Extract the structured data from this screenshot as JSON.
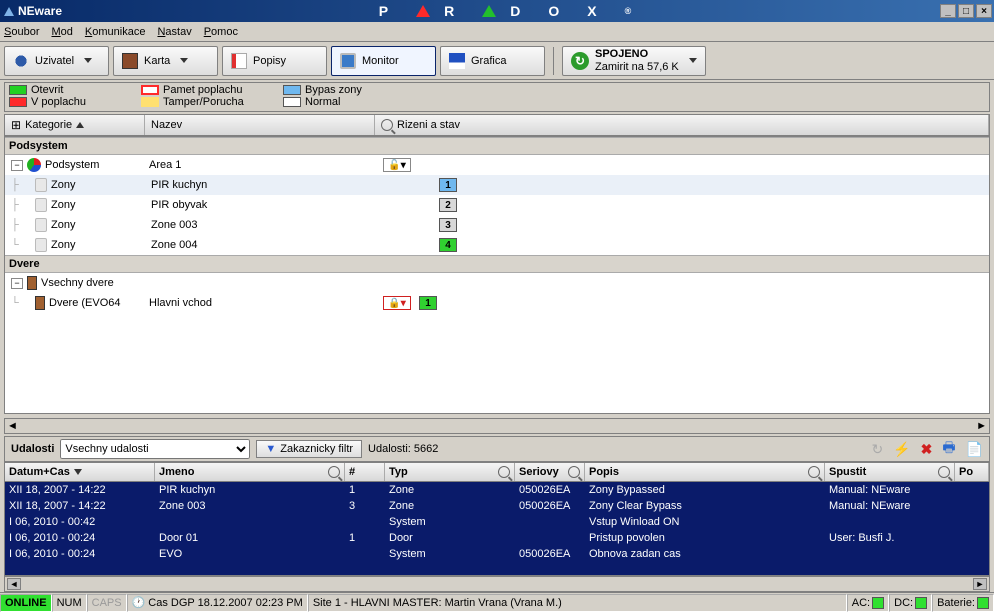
{
  "title": "NEware",
  "brand_letters": [
    "P",
    "R",
    "D",
    "O",
    "X"
  ],
  "brand_triangles": [
    "#ff2a2a",
    "#22c02c"
  ],
  "brand_reg": "®",
  "menu": [
    "Soubor",
    "Mod",
    "Komunikace",
    "Nastav",
    "Pomoc"
  ],
  "toolbar": {
    "user": "Uzivatel",
    "card": "Karta",
    "labels": "Popisy",
    "monitor": "Monitor",
    "grafica": "Grafica",
    "conn_status": "SPOJENO",
    "conn_detail": "Zamirit na  57,6 K"
  },
  "legend": {
    "open": "Otevrit",
    "open_color": "#22d022",
    "alarm": "V poplachu",
    "alarm_color": "#ff2a2a",
    "alarm_mem": "Pamet poplachu",
    "alarm_mem_border": "#ff2a2a",
    "tamper": "Tamper/Porucha",
    "tamper_color": "#ffe070",
    "bypass": "Bypas zony",
    "bypass_color": "#6fb8ef",
    "normal": "Normal",
    "normal_color": "#ffffff"
  },
  "columns": {
    "category": "Kategorie",
    "name": "Nazev",
    "status": "Rizeni a stav"
  },
  "sections": {
    "podsystem": "Podsystem",
    "dvere": "Dvere"
  },
  "tree": {
    "podsystem_label": "Podsystem",
    "area1": "Area 1",
    "rows": [
      {
        "cat": "Zony",
        "name": "PIR kuchyn",
        "num": "1",
        "color": "#6fb8ef"
      },
      {
        "cat": "Zony",
        "name": "PIR obyvak",
        "num": "2",
        "color": "#d8d8d8"
      },
      {
        "cat": "Zony",
        "name": "Zone 003",
        "num": "3",
        "color": "#d8d8d8"
      },
      {
        "cat": "Zony",
        "name": "Zone 004",
        "num": "4",
        "color": "#30d030"
      }
    ],
    "all_doors": "Vsechny dvere",
    "door1_cat": "Dvere (EVO64",
    "door1_name": "Hlavni vchod",
    "door1_badge": "1"
  },
  "events": {
    "label": "Udalosti",
    "dropdown": "Vsechny udalosti",
    "filter": "Zakaznicky filtr",
    "count_label": "Udalosti: 5662",
    "headers": {
      "dt": "Datum+Cas",
      "jmeno": "Jmeno",
      "num": "#",
      "typ": "Typ",
      "seriovy": "Seriovy",
      "popis": "Popis",
      "spustit": "Spustit",
      "po": "Po"
    },
    "rows": [
      {
        "dt": "XII 18, 2007 - 14:22",
        "jmeno": "PIR kuchyn",
        "num": "1",
        "typ": "Zone",
        "ser": "050026EA",
        "popis": "Zony Bypassed",
        "spustit": "Manual: NEware"
      },
      {
        "dt": "XII 18, 2007 - 14:22",
        "jmeno": "Zone 003",
        "num": "3",
        "typ": "Zone",
        "ser": "050026EA",
        "popis": "Zony Clear Bypass",
        "spustit": "Manual: NEware"
      },
      {
        "dt": "I 06, 2010 - 00:42",
        "jmeno": "",
        "num": "",
        "typ": "System",
        "ser": "",
        "popis": "Vstup Winload ON",
        "spustit": ""
      },
      {
        "dt": "I 06, 2010 - 00:24",
        "jmeno": "Door 01",
        "num": "1",
        "typ": "Door",
        "ser": "",
        "popis": "Pristup povolen",
        "spustit": "User: Busfi J."
      },
      {
        "dt": "I 06, 2010 - 00:24",
        "jmeno": "EVO",
        "num": "",
        "typ": "System",
        "ser": "050026EA",
        "popis": "Obnova zadan cas",
        "spustit": ""
      }
    ]
  },
  "status": {
    "online": "ONLINE",
    "num": "NUM",
    "caps": "CAPS",
    "clock": "Cas DGP 18.12.2007  02:23 PM",
    "site": "Site 1 - HLAVNI MASTER: Martin Vrana (Vrana M.)",
    "ac": "AC:",
    "dc": "DC:",
    "bat": "Baterie:"
  }
}
